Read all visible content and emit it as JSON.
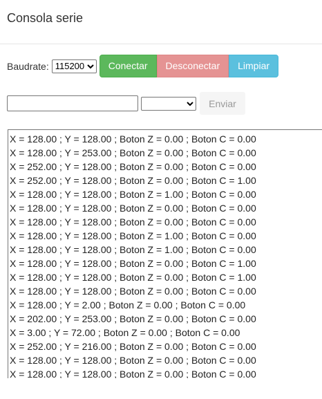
{
  "header": {
    "title": "Consola serie"
  },
  "controls": {
    "baud_label": "Baudrate:",
    "baud_value": "115200",
    "connect_label": "Conectar",
    "disconnect_label": "Desconectar",
    "clear_label": "Limpiar"
  },
  "send": {
    "input_value": "",
    "eol_value": "",
    "send_label": "Enviar"
  },
  "console": {
    "lines": [
      "X = 128.00 ; Y = 128.00 ; Boton Z = 0.00 ; Boton C = 0.00",
      "X = 128.00 ; Y = 253.00 ; Boton Z = 0.00 ; Boton C = 0.00",
      "X = 252.00 ; Y = 128.00 ; Boton Z = 0.00 ; Boton C = 0.00",
      "X = 252.00 ; Y = 128.00 ; Boton Z = 0.00 ; Boton C = 1.00",
      "X = 128.00 ; Y = 128.00 ; Boton Z = 1.00 ; Boton C = 0.00",
      "X = 128.00 ; Y = 128.00 ; Boton Z = 0.00 ; Boton C = 0.00",
      "X = 128.00 ; Y = 128.00 ; Boton Z = 0.00 ; Boton C = 0.00",
      "X = 128.00 ; Y = 128.00 ; Boton Z = 1.00 ; Boton C = 0.00",
      "X = 128.00 ; Y = 128.00 ; Boton Z = 1.00 ; Boton C = 0.00",
      "X = 128.00 ; Y = 128.00 ; Boton Z = 0.00 ; Boton C = 1.00",
      "X = 128.00 ; Y = 128.00 ; Boton Z = 0.00 ; Boton C = 1.00",
      "X = 128.00 ; Y = 128.00 ; Boton Z = 0.00 ; Boton C = 0.00",
      "X = 128.00 ; Y = 2.00 ; Boton Z = 0.00 ; Boton C = 0.00",
      "X = 202.00 ; Y = 253.00 ; Boton Z = 0.00 ; Boton C = 0.00",
      "X = 3.00 ; Y = 72.00 ; Boton Z = 0.00 ; Boton C = 0.00",
      "X = 252.00 ; Y = 216.00 ; Boton Z = 0.00 ; Boton C = 0.00",
      "X = 128.00 ; Y = 128.00 ; Boton Z = 0.00 ; Boton C = 0.00",
      "X = 128.00 ; Y = 128.00 ; Boton Z = 0.00 ; Boton C = 0.00"
    ]
  },
  "colors": {
    "connect": "#5cb85c",
    "disconnect": "#e59393",
    "clear": "#5bc0de"
  }
}
